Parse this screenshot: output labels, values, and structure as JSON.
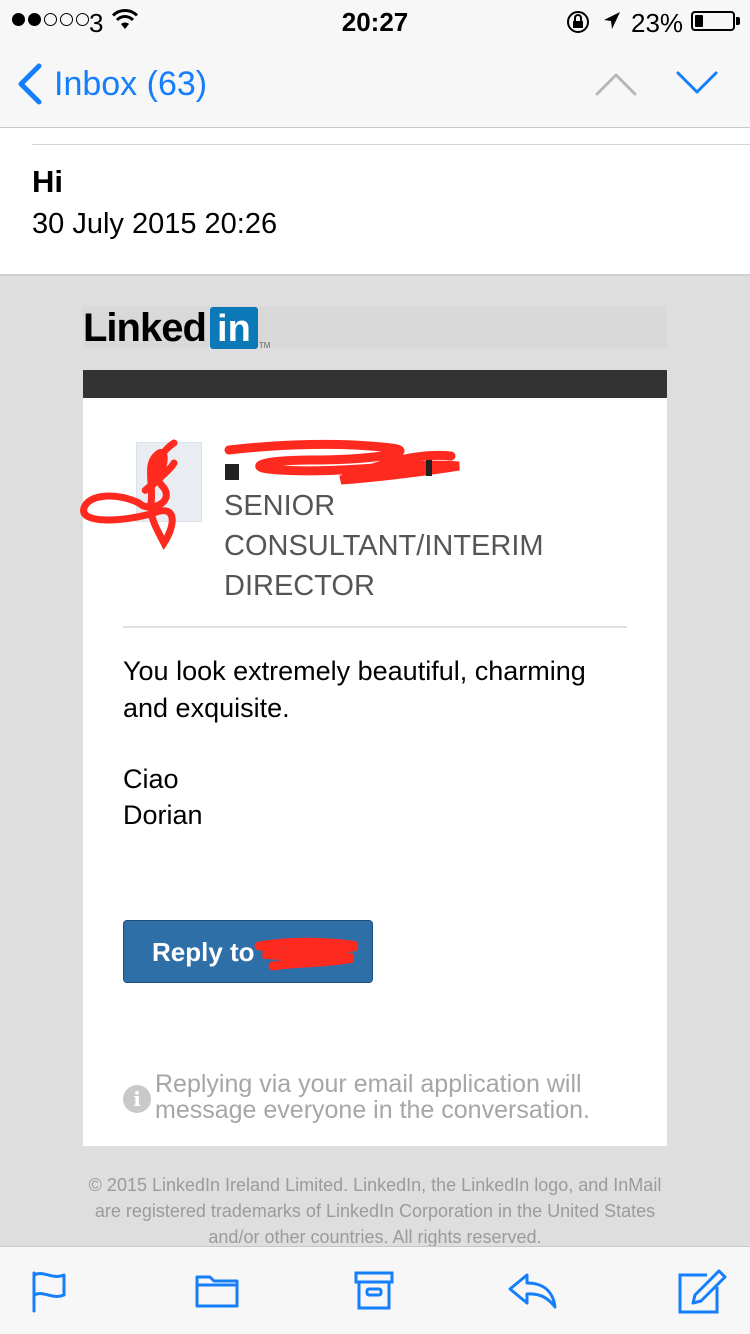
{
  "status_bar": {
    "carrier": "3",
    "time": "20:27",
    "battery_percent": "23%",
    "battery_level": 0.23,
    "signal_bars": 2,
    "signal_total": 5
  },
  "nav": {
    "back_label": "Inbox (63)",
    "icons": [
      "chevron-left-icon",
      "chevron-up-icon",
      "chevron-down-icon"
    ]
  },
  "header": {
    "subject": "Hi",
    "date": "30 July 2015 20:26"
  },
  "email": {
    "brand_text": "Linked",
    "brand_box": "in",
    "brand_tm": "TM",
    "sender_title": "SENIOR CONSULTANT/INTERIM DIRECTOR",
    "message": "You look extremely beautiful, charming and exquisite.",
    "signoff_line1": "Ciao",
    "signoff_line2": "Dorian",
    "reply_label": "Reply to",
    "note_icon": "i",
    "note": "Replying via your email application will message everyone in the conversation.",
    "footer": "© 2015 LinkedIn Ireland Limited. LinkedIn, the LinkedIn logo, and InMail are registered trademarks of LinkedIn Corporation in the United States and/or other countries. All rights reserved."
  },
  "colors": {
    "ios_blue": "#157efb",
    "linkedin_blue": "#0b78b7",
    "button_blue": "#2f6fa8",
    "redaction_red": "#ff2a1f"
  },
  "toolbar": {
    "icons": [
      "flag-icon",
      "folder-icon",
      "archive-icon",
      "reply-icon",
      "compose-icon"
    ]
  }
}
